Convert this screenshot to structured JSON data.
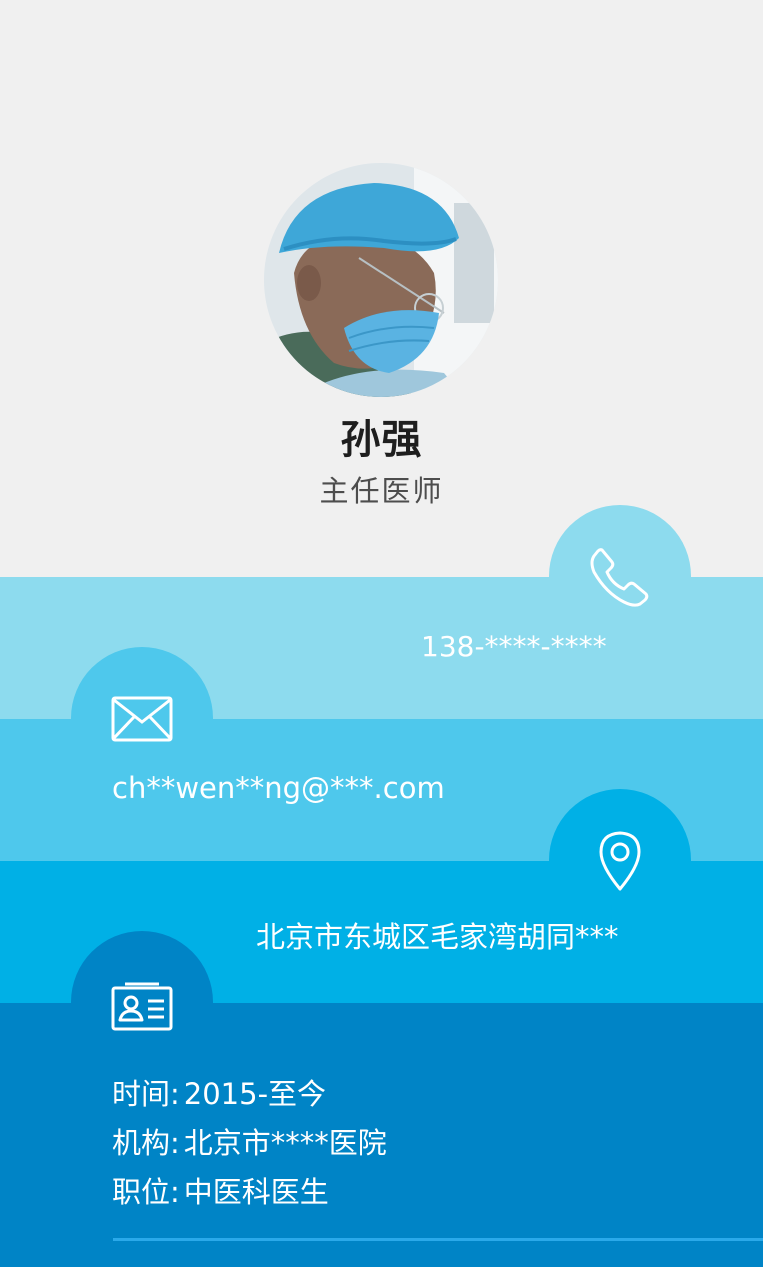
{
  "profile": {
    "name": "孙强",
    "title": "主任医师",
    "avatar_alt": "doctor-photo"
  },
  "contact": {
    "phone": "138-****-****",
    "email": "ch**wen**ng@***.com",
    "address": "北京市东城区毛家湾胡同***"
  },
  "work": {
    "time_label": "时间:",
    "time_value": "2015-至今",
    "org_label": "机构:",
    "org_value": "北京市****医院",
    "position_label": "职位:",
    "position_value": "中医科医生"
  },
  "icons": {
    "phone": "phone-icon",
    "email": "envelope-icon",
    "address": "location-pin-icon",
    "work": "id-card-icon"
  },
  "colors": {
    "background": "#f0f0f0",
    "band_phone": "#8ddbee",
    "band_email": "#4ec8ec",
    "band_address": "#00b0e6",
    "band_work": "#0084c6"
  }
}
